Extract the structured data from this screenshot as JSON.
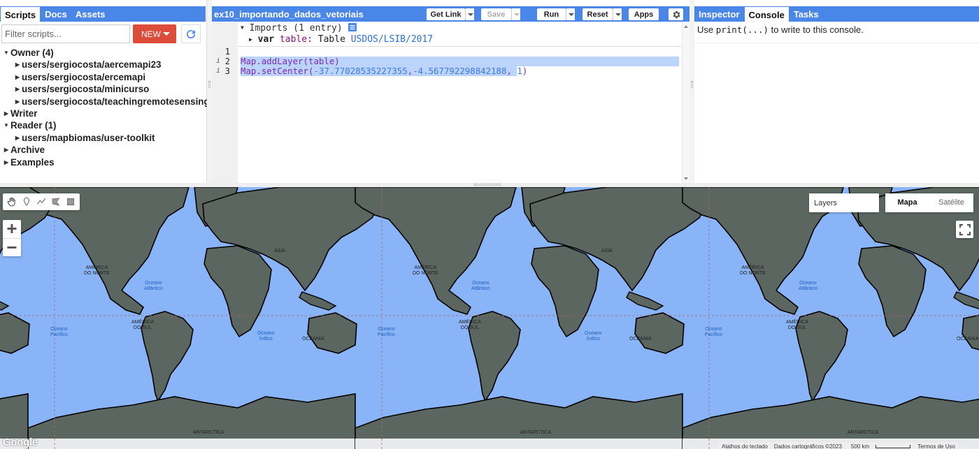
{
  "left_panel": {
    "tabs": [
      {
        "label": "Scripts",
        "active": true
      },
      {
        "label": "Docs",
        "active": false
      },
      {
        "label": "Assets",
        "active": false
      }
    ],
    "filter_placeholder": "Filter scripts...",
    "new_label": "NEW",
    "tree": [
      {
        "label": "Owner (4)",
        "expanded": true
      },
      {
        "label": "users/sergiocosta/aercemapi23"
      },
      {
        "label": "users/sergiocosta/ercemapi"
      },
      {
        "label": "users/sergiocosta/minicurso"
      },
      {
        "label": "users/sergiocosta/teachingremotesensing"
      },
      {
        "label": "Writer",
        "expanded": false
      },
      {
        "label": "Reader (1)",
        "expanded": true
      },
      {
        "label": "users/mapbiomas/user-toolkit"
      },
      {
        "label": "Archive",
        "expanded": false
      },
      {
        "label": "Examples",
        "expanded": false
      }
    ]
  },
  "editor": {
    "file_title": "ex10_importando_dados_vetoriais",
    "buttons": {
      "get_link": "Get Link",
      "save": "Save",
      "run": "Run",
      "reset": "Reset",
      "apps": "Apps"
    },
    "imports_header": "Imports (1 entry)",
    "import_var_keyword": "var",
    "import_var_name": "table:",
    "import_var_type": "Table",
    "import_var_asset": "USDOS/LSIB/2017",
    "line_numbers": [
      "1",
      "2",
      "3"
    ],
    "lines": [
      {
        "fn": "Map.addLayer",
        "args": "(table)"
      },
      {
        "fn": "Map.setCenter",
        "open": "(",
        "a1": "-37.77028535227355",
        "comma1": ",",
        "a2": "-4.567792298842188",
        "comma2": ", ",
        "a3": "1",
        "close": ")"
      }
    ]
  },
  "right_panel": {
    "tabs": [
      {
        "label": "Inspector",
        "active": false
      },
      {
        "label": "Console",
        "active": true
      },
      {
        "label": "Tasks",
        "active": false
      }
    ],
    "console_pre": "Use ",
    "console_code": "print(...)",
    "console_post": " to write to this console."
  },
  "map": {
    "layers_label": "Layers",
    "map_type_on": "Mapa",
    "map_type_off": "Satélite",
    "labels": {
      "north_america": "AMÉRICA\nDO NORTE",
      "south_america": "AMÉRICA\nDO SUL",
      "asia": "ÁSIA",
      "oceania": "OCEANIA",
      "antarctica": "ANTARCTICA",
      "atlantic": "Oceano\nAtlântico",
      "pacific": "Oceano\nPacífico",
      "indian": "Oceano\nÍndico"
    },
    "footer": {
      "keyboard": "Atalhos do teclado",
      "map_data": "Dados cartográficos ©2023",
      "scale": "500 km",
      "terms": "Termos de Uso"
    },
    "google": "Google",
    "colors": {
      "ocean": "#8ab4f8",
      "land": "#5b6660",
      "ice": "#e8eaec",
      "accent": "#4a86e8"
    }
  }
}
